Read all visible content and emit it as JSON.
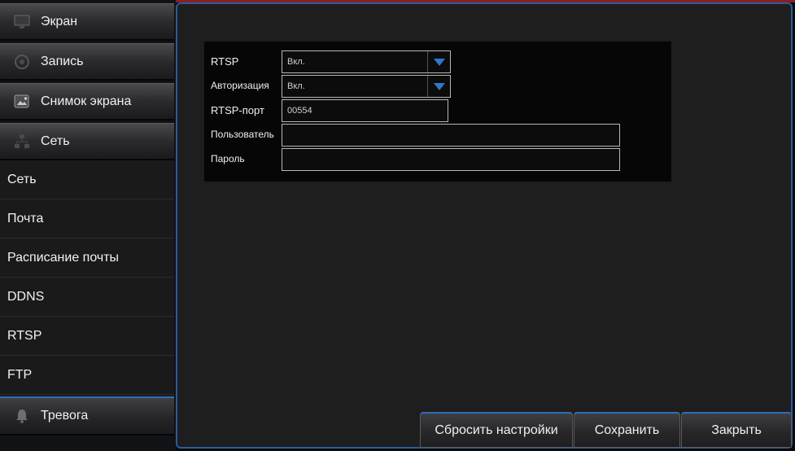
{
  "sidebar": {
    "categories": [
      {
        "label": "Экран",
        "icon": "monitor-icon"
      },
      {
        "label": "Запись",
        "icon": "record-icon"
      },
      {
        "label": "Снимок экрана",
        "icon": "snapshot-icon"
      },
      {
        "label": "Сеть",
        "icon": "network-icon"
      }
    ],
    "sub_items": [
      "Сеть",
      "Почта",
      "Расписание почты",
      "DDNS",
      "RTSP",
      "FTP"
    ],
    "selected_sub": "RTSP",
    "alarm": {
      "label": "Тревога",
      "icon": "alarm-bell-icon"
    }
  },
  "form": {
    "rtsp": {
      "label": "RTSP",
      "value": "Вкл."
    },
    "auth": {
      "label": "Авторизация",
      "value": "Вкл."
    },
    "port": {
      "label": "RTSP-порт",
      "value": "00554"
    },
    "user": {
      "label": "Пользователь",
      "value": ""
    },
    "password": {
      "label": "Пароль",
      "value": ""
    }
  },
  "buttons": {
    "reset": "Сбросить настройки",
    "save": "Сохранить",
    "close": "Закрыть"
  },
  "colors": {
    "accent": "#2e6fb8",
    "dropdown_arrow": "#2f78c8",
    "panel_bg": "#1e1e1f"
  }
}
